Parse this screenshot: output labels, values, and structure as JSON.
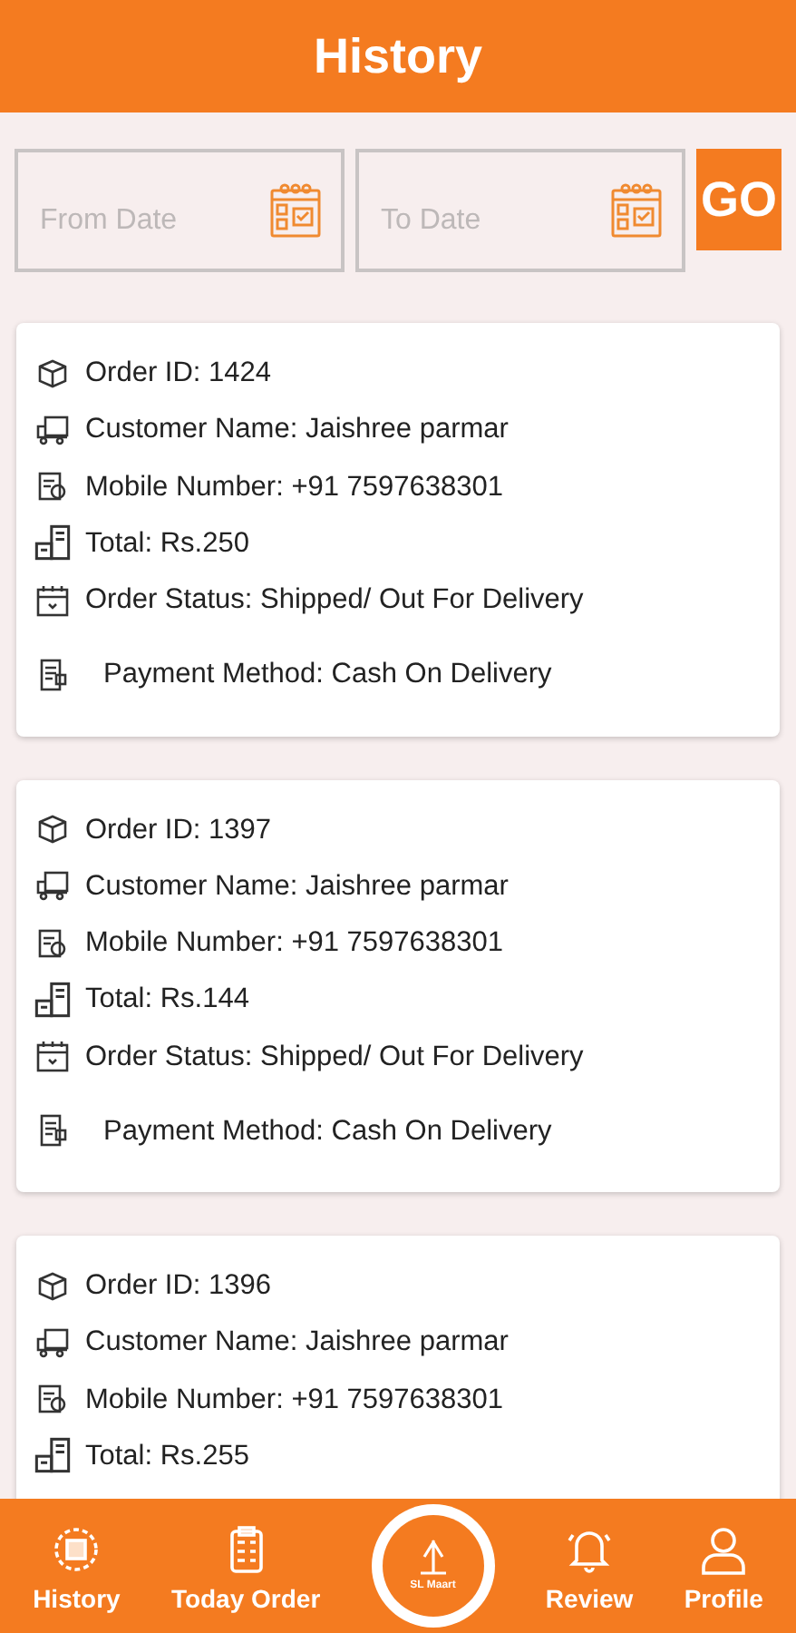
{
  "header": {
    "title": "History"
  },
  "filters": {
    "from": {
      "placeholder": "From Date"
    },
    "to": {
      "placeholder": "To Date"
    },
    "go": "GO"
  },
  "orders": [
    {
      "fields": [
        {
          "kind": "order",
          "text": "Order ID: 1424"
        },
        {
          "kind": "customer",
          "text": "Customer Name: Jaishree  parmar"
        },
        {
          "kind": "mobile",
          "text": "Mobile Number: +91 7597638301"
        },
        {
          "kind": "total",
          "text": "Total: Rs.250"
        },
        {
          "kind": "status",
          "text": "Order Status: Shipped/ Out For Delivery"
        },
        {
          "kind": "payment",
          "text": "Payment Method: Cash On Delivery"
        }
      ]
    },
    {
      "fields": [
        {
          "kind": "order",
          "text": "Order ID: 1397"
        },
        {
          "kind": "customer",
          "text": "Customer Name: Jaishree  parmar"
        },
        {
          "kind": "mobile",
          "text": "Mobile Number: +91 7597638301"
        },
        {
          "kind": "total",
          "text": "Total: Rs.144"
        },
        {
          "kind": "status",
          "text": "Order Status: Shipped/ Out For Delivery"
        },
        {
          "kind": "payment",
          "text": "Payment Method: Cash On Delivery"
        }
      ]
    },
    {
      "fields": [
        {
          "kind": "order",
          "text": "Order ID: 1396"
        },
        {
          "kind": "customer",
          "text": "Customer Name: Jaishree  parmar"
        },
        {
          "kind": "mobile",
          "text": "Mobile Number: +91 7597638301"
        },
        {
          "kind": "total",
          "text": "Total: Rs.255"
        }
      ]
    }
  ],
  "nav": [
    {
      "kind": "history",
      "label": "History"
    },
    {
      "kind": "today",
      "label": "Today Order"
    },
    {
      "kind": "logo",
      "label": "SL Maart"
    },
    {
      "kind": "review",
      "label": "Review"
    },
    {
      "kind": "profile",
      "label": "Profile"
    }
  ]
}
